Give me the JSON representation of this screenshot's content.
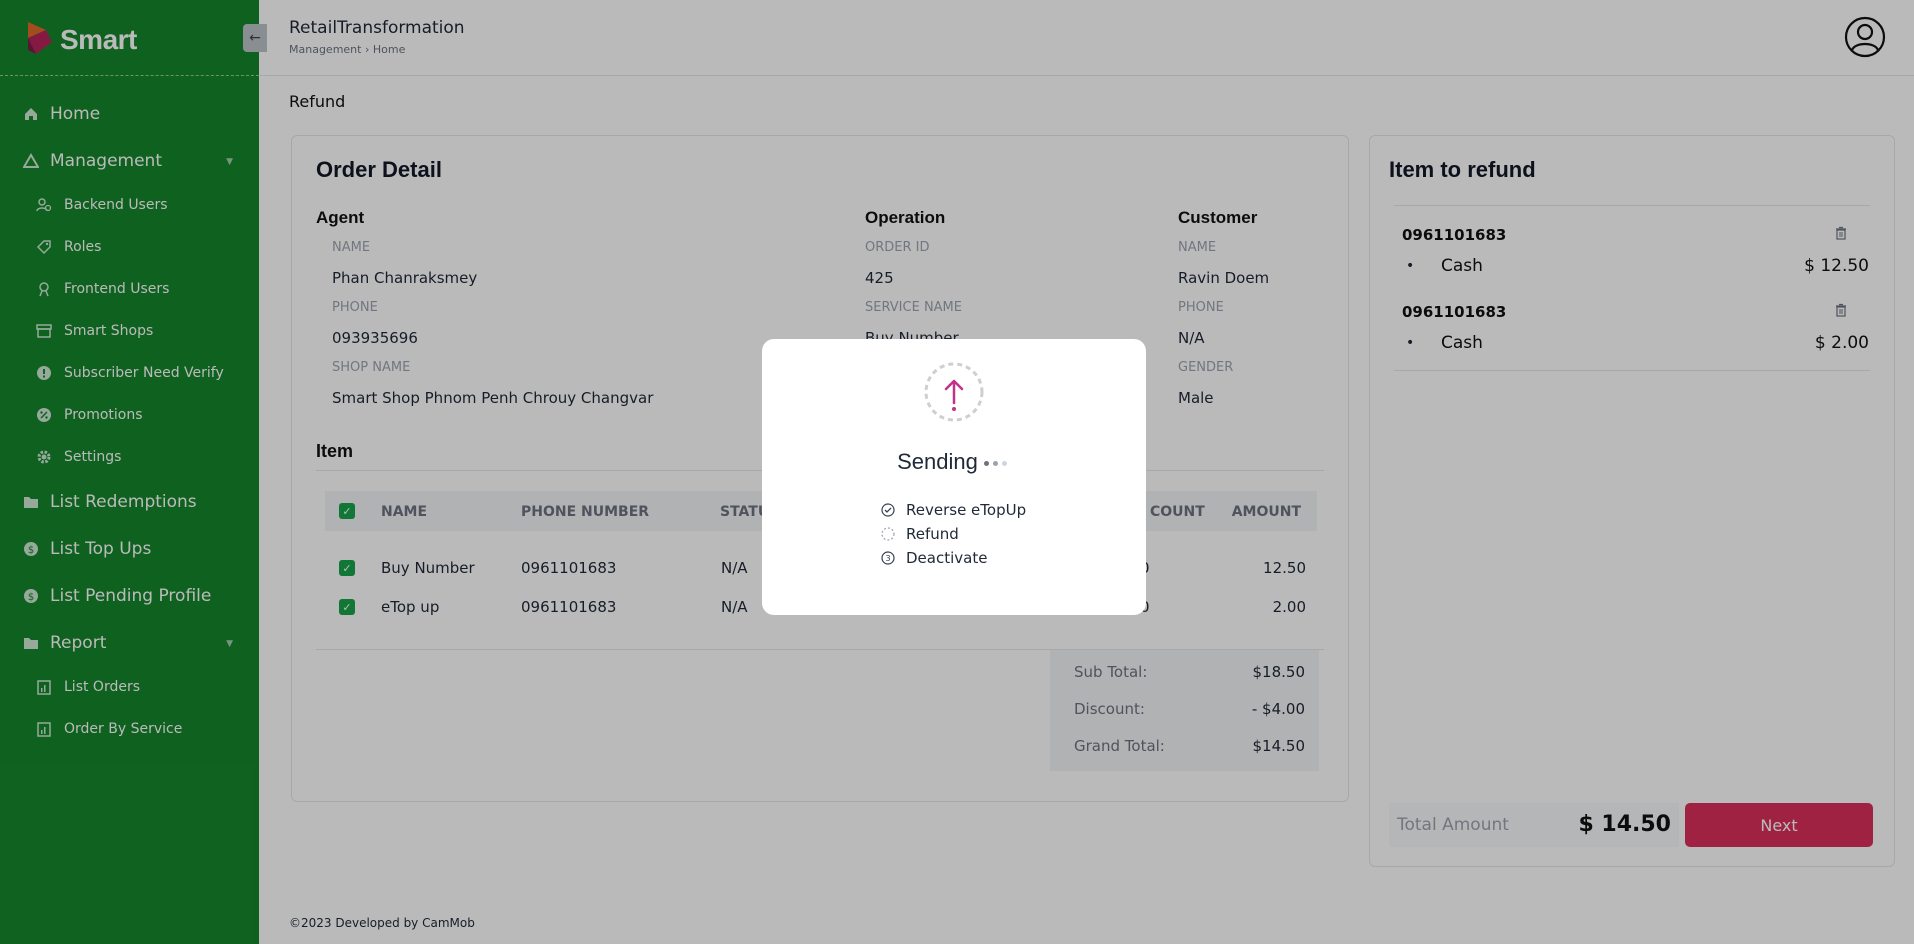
{
  "brand": {
    "name": "Smart",
    "collapse_icon": "arrow-left-icon"
  },
  "header": {
    "title": "RetailTransformation",
    "breadcrumb": [
      "Management",
      "Home"
    ],
    "breadcrumb_sep": "›"
  },
  "nav": {
    "home": "Home",
    "management": "Management",
    "management_items": {
      "backend_users": "Backend Users",
      "roles": "Roles",
      "frontend_users": "Frontend Users",
      "smart_shops": "Smart Shops",
      "subscriber_need_verify": "Subscriber Need Verify",
      "promotions": "Promotions",
      "settings": "Settings"
    },
    "list_redemptions": "List Redemptions",
    "list_top_ups": "List Top Ups",
    "list_pending_profile": "List Pending Profile",
    "report": "Report",
    "report_items": {
      "list_orders": "List Orders",
      "order_by_service": "Order By Service"
    }
  },
  "page": {
    "label": "Refund"
  },
  "order_detail": {
    "title": "Order Detail",
    "agent": {
      "heading": "Agent",
      "name_label": "NAME",
      "name": "Phan Chanraksmey",
      "phone_label": "PHONE",
      "phone": "093935696",
      "shop_label": "SHOP NAME",
      "shop": "Smart Shop Phnom Penh Chrouy Changvar"
    },
    "operation": {
      "heading": "Operation",
      "order_id_label": "ORDER ID",
      "order_id": "425",
      "service_label": "SERVICE NAME",
      "service": "Buy Number"
    },
    "customer": {
      "heading": "Customer",
      "name_label": "NAME",
      "name": "Ravin Doem",
      "phone_label": "PHONE",
      "phone": "N/A",
      "gender_label": "GENDER",
      "gender": "Male"
    },
    "item_title": "Item",
    "table": {
      "headers": {
        "name": "NAME",
        "phone": "PHONE NUMBER",
        "status": "STATU",
        "discount": "COUNT",
        "amount": "AMOUNT"
      },
      "rows": [
        {
          "name": "Buy Number",
          "phone": "0961101683",
          "status": "N/A",
          "discount": "0",
          "amount": "12.50"
        },
        {
          "name": "eTop up",
          "phone": "0961101683",
          "status": "N/A",
          "discount": "0",
          "amount": "2.00"
        }
      ]
    },
    "totals": {
      "sub_total_label": "Sub Total:",
      "sub_total": "$18.50",
      "discount_label": "Discount:",
      "discount": "- $4.00",
      "grand_total_label": "Grand Total:",
      "grand_total": "$14.50"
    }
  },
  "refund": {
    "title": "Item to refund",
    "items": [
      {
        "phone": "0961101683",
        "method": "Cash",
        "amount": "$ 12.50"
      },
      {
        "phone": "0961101683",
        "method": "Cash",
        "amount": "$ 2.00"
      }
    ],
    "total_label": "Total Amount",
    "total": "$ 14.50",
    "next_label": "Next"
  },
  "footer": {
    "text": "©2023  Developed by CamMob"
  },
  "modal": {
    "title": "Sending",
    "icon": "upload-progress-icon",
    "steps": [
      {
        "label": "Reverse eTopUp",
        "state": "done"
      },
      {
        "label": "Refund",
        "state": "loading"
      },
      {
        "label": "Deactivate",
        "state": "pending"
      }
    ]
  },
  "colors": {
    "sidebar": "#14862a",
    "accent": "#dc2f5b",
    "modal_icon": "#c0338a",
    "check": "#16a34a"
  }
}
